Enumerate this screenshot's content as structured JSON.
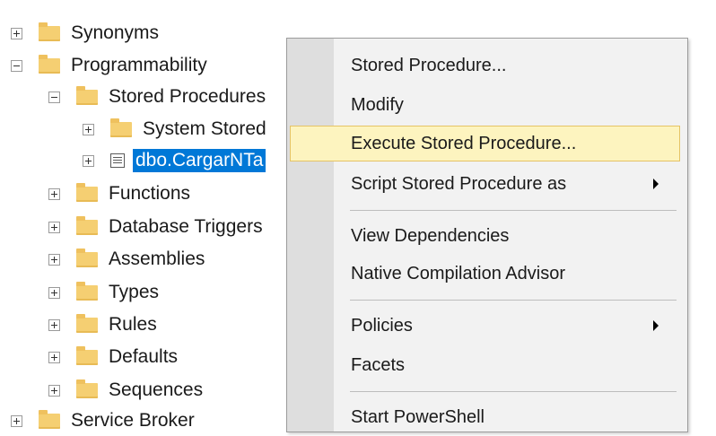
{
  "tree": {
    "items": [
      {
        "label": "Synonyms",
        "expander": "plus",
        "icon": "folder-icon"
      },
      {
        "label": "Programmability",
        "expander": "minus",
        "icon": "folder-icon"
      },
      {
        "label": "Stored Procedures",
        "expander": "minus",
        "icon": "folder-icon"
      },
      {
        "label": "System Stored",
        "expander": "plus",
        "icon": "folder-icon"
      },
      {
        "label": "dbo.CargarNTa",
        "expander": "plus",
        "icon": "stored-procedure-icon",
        "selected": true
      },
      {
        "label": "Functions",
        "expander": "plus",
        "icon": "folder-icon"
      },
      {
        "label": "Database Triggers",
        "expander": "plus",
        "icon": "folder-icon"
      },
      {
        "label": "Assemblies",
        "expander": "plus",
        "icon": "folder-icon"
      },
      {
        "label": "Types",
        "expander": "plus",
        "icon": "folder-icon"
      },
      {
        "label": "Rules",
        "expander": "plus",
        "icon": "folder-icon"
      },
      {
        "label": "Defaults",
        "expander": "plus",
        "icon": "folder-icon"
      },
      {
        "label": "Sequences",
        "expander": "plus",
        "icon": "folder-icon"
      },
      {
        "label": "Service Broker",
        "expander": "plus",
        "icon": "folder-icon"
      }
    ]
  },
  "context_menu": {
    "items": [
      {
        "label": "Stored Procedure..."
      },
      {
        "label": "Modify"
      },
      {
        "label": "Execute Stored Procedure...",
        "highlighted": true
      },
      {
        "label": "Script Stored Procedure as",
        "submenu": true
      },
      {
        "label": "View Dependencies"
      },
      {
        "label": "Native Compilation Advisor"
      },
      {
        "label": "Policies",
        "submenu": true
      },
      {
        "label": "Facets"
      },
      {
        "label": "Start PowerShell"
      }
    ]
  },
  "colors": {
    "selection": "#0078d7",
    "menu_highlight": "#fdf4bf",
    "menu_highlight_border": "#e5c365",
    "folder": "#f5cf72"
  }
}
